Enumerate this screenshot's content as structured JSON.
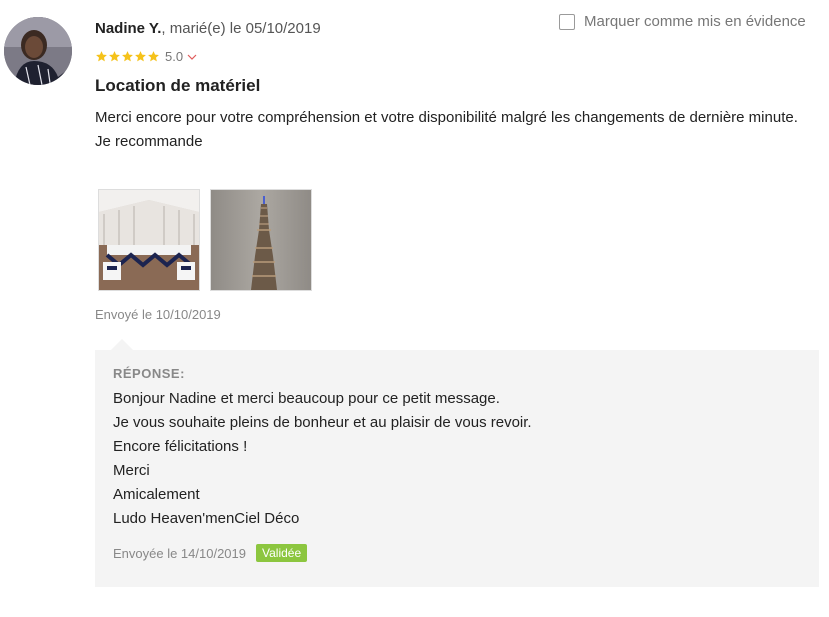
{
  "review": {
    "author": "Nadine Y.",
    "author_suffix": ", marié(e) le 05/10/2019",
    "highlight_label": "Marquer comme mis en évidence",
    "rating_value": "5.0",
    "rating_stars": 5,
    "title": "Location de matériel",
    "body": [
      "Merci encore pour votre compréhension et votre disponibilité malgré les changements de dernière minute.",
      "Je recommande"
    ],
    "sent_date": "Envoyé le 10/10/2019"
  },
  "reply": {
    "heading": "RÉPONSE:",
    "lines": [
      "Bonjour Nadine et merci beaucoup pour ce petit message.",
      "Je vous souhaite pleins de bonheur et au plaisir de vous revoir.",
      "Encore félicitations !",
      "Merci",
      "Amicalement",
      "Ludo Heaven'menCiel Déco"
    ],
    "sent_date": "Envoyée le 14/10/2019",
    "status_badge": "Validée"
  },
  "icons": {
    "star": "star-icon",
    "chevron": "chevron-down-icon",
    "checkbox": "checkbox"
  },
  "colors": {
    "star": "#f5c21b",
    "chevron": "#e05a5a",
    "badge": "#8cc63f",
    "reply_bg": "#f4f4f4"
  }
}
